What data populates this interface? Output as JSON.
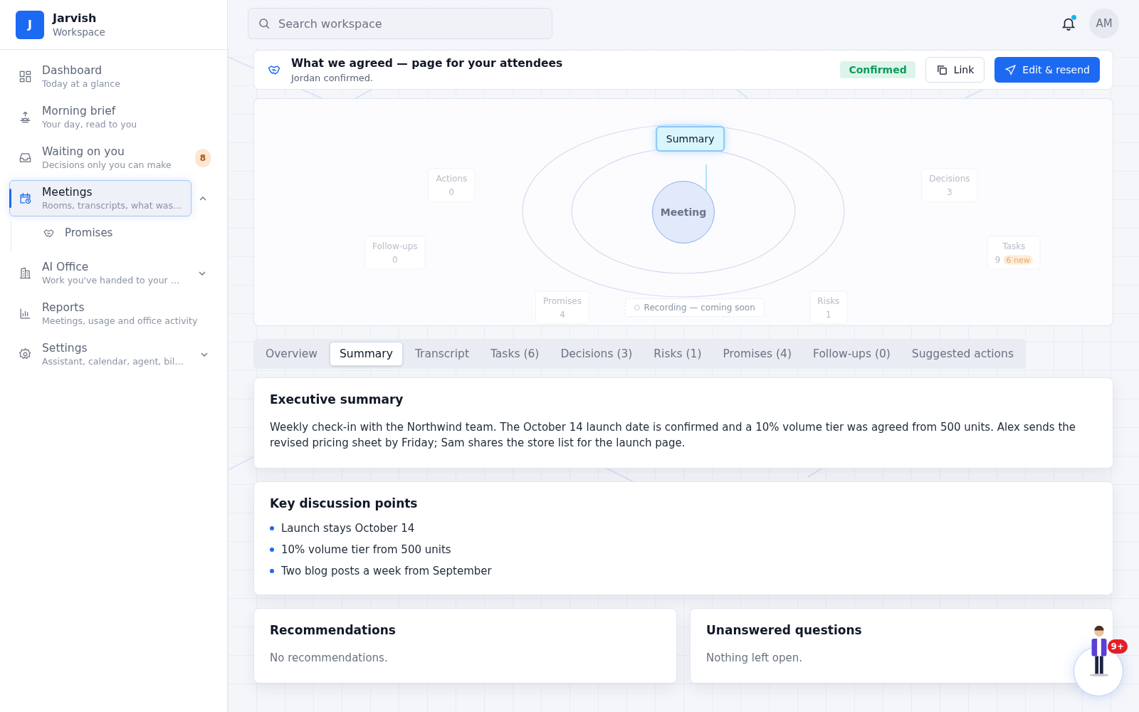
{
  "brand": {
    "initial": "J",
    "name": "Jarvish",
    "subtitle": "Workspace"
  },
  "sidebar": {
    "items": [
      {
        "kind": "dashboard",
        "label": "Dashboard",
        "description": "Today at a glance",
        "selected": false
      },
      {
        "kind": "brief",
        "label": "Morning brief",
        "description": "Your day, read to you",
        "selected": false
      },
      {
        "kind": "inbox",
        "label": "Waiting on you",
        "description": "Decisions only you can make",
        "selected": false,
        "badge": "8"
      },
      {
        "kind": "meetings",
        "label": "Meetings",
        "description": "Rooms, transcripts, what was…",
        "selected": true,
        "expanded": true,
        "children": [
          {
            "label": "Promises"
          }
        ]
      },
      {
        "kind": "office",
        "label": "AI Office",
        "description": "Work you've handed to your …",
        "selected": false,
        "expanded": false
      },
      {
        "kind": "reports",
        "label": "Reports",
        "description": "Meetings, usage and office activity",
        "selected": false
      },
      {
        "kind": "settings",
        "label": "Settings",
        "description": "Assistant, calendar, agent, bil…",
        "selected": false,
        "expanded": false
      }
    ]
  },
  "topbar": {
    "search": {
      "placeholder": "Search workspace"
    },
    "notifications": {
      "unread": true
    },
    "avatar": "AM"
  },
  "header_card": {
    "title": "What we agreed — page for your attendees",
    "subtitle": "Jordan confirmed.",
    "status": "Confirmed",
    "buttons": [
      {
        "kind": "link",
        "label": "Link"
      },
      {
        "kind": "send",
        "label": "Edit & resend"
      }
    ]
  },
  "map": {
    "center": "Meeting",
    "focus": "Summary",
    "recording": "Recording — coming soon",
    "nodes": [
      {
        "label": "Actions",
        "count": "0"
      },
      {
        "label": "Decisions",
        "count": "3"
      },
      {
        "label": "Follow-ups",
        "count": "0"
      },
      {
        "label": "Tasks",
        "count": "9",
        "badge": "6 new"
      },
      {
        "label": "Promises",
        "count": "4"
      },
      {
        "label": "Risks",
        "count": "1"
      }
    ]
  },
  "tabs": [
    {
      "label": "Overview",
      "selected": false
    },
    {
      "label": "Summary",
      "selected": true
    },
    {
      "label": "Transcript",
      "selected": false
    },
    {
      "label": "Tasks (6)",
      "selected": false
    },
    {
      "label": "Decisions (3)",
      "selected": false
    },
    {
      "label": "Risks (1)",
      "selected": false
    },
    {
      "label": "Promises (4)",
      "selected": false
    },
    {
      "label": "Follow-ups (0)",
      "selected": false
    },
    {
      "label": "Suggested actions",
      "selected": false
    }
  ],
  "executive_summary": {
    "title": "Executive summary",
    "text": "Weekly check-in with the Northwind team. The October 14 launch date is confirmed and a 10% volume tier was agreed from 500 units. Alex sends the revised pricing sheet by Friday; Sam shares the store list for the launch page."
  },
  "key_points": {
    "title": "Key discussion points",
    "items": [
      "Launch stays October 14",
      "10% volume tier from 500 units",
      "Two blog posts a week from September"
    ]
  },
  "recommendations": {
    "title": "Recommendations",
    "text": "No recommendations."
  },
  "questions": {
    "title": "Unanswered questions",
    "text": "Nothing left open."
  },
  "assistant": {
    "badge": "9+"
  }
}
